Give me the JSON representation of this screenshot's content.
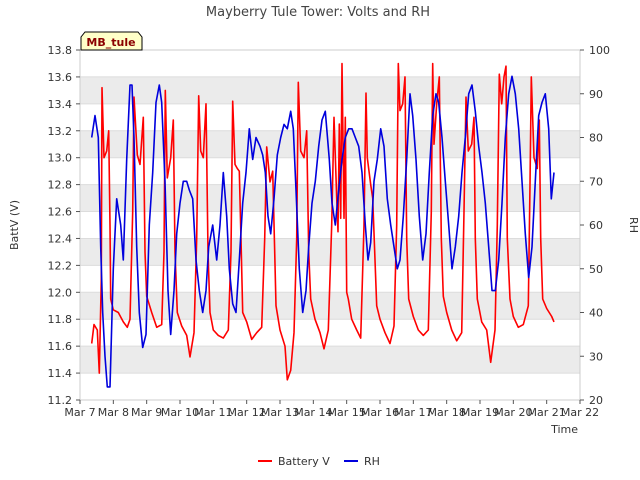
{
  "chart_data": {
    "type": "line",
    "title": "Mayberry Tule Tower: Volts and RH",
    "site_label": "MB_tule",
    "xlabel": "Time",
    "ylabel_left": "BattV (V)",
    "ylabel_right": "RH",
    "x_ticks": [
      "Mar 7",
      "Mar 8",
      "Mar 9",
      "Mar 10",
      "Mar 11",
      "Mar 12",
      "Mar 13",
      "Mar 14",
      "Mar 15",
      "Mar 16",
      "Mar 17",
      "Mar 18",
      "Mar 19",
      "Mar 20",
      "Mar 21",
      "Mar 22"
    ],
    "xlim_days": [
      7,
      22
    ],
    "ylim_left": [
      11.2,
      13.8
    ],
    "yticks_left": [
      "11.2",
      "11.4",
      "11.6",
      "11.8",
      "12.0",
      "12.2",
      "12.4",
      "12.6",
      "12.8",
      "13.0",
      "13.2",
      "13.4",
      "13.6",
      "13.8"
    ],
    "ylim_right": [
      20,
      100
    ],
    "yticks_right": [
      "20",
      "30",
      "40",
      "50",
      "60",
      "70",
      "80",
      "90",
      "100"
    ],
    "grid": true,
    "legend_position": "bottom-center",
    "colors": {
      "battery": "#ff0000",
      "rh": "#0000dd",
      "band": "#ebebeb",
      "grid": "#dcdcdc",
      "label_bg": "#ffffc8",
      "label_text": "#8b0000"
    },
    "series": [
      {
        "name": "Battery V",
        "axis": "left",
        "points": [
          [
            7.35,
            11.62
          ],
          [
            7.42,
            11.76
          ],
          [
            7.52,
            11.72
          ],
          [
            7.58,
            11.4
          ],
          [
            7.64,
            12.1
          ],
          [
            7.66,
            13.52
          ],
          [
            7.72,
            13.0
          ],
          [
            7.8,
            13.05
          ],
          [
            7.86,
            13.2
          ],
          [
            7.9,
            12.5
          ],
          [
            7.92,
            11.95
          ],
          [
            8.0,
            11.87
          ],
          [
            8.15,
            11.85
          ],
          [
            8.3,
            11.78
          ],
          [
            8.42,
            11.74
          ],
          [
            8.5,
            11.8
          ],
          [
            8.58,
            12.6
          ],
          [
            8.62,
            13.45
          ],
          [
            8.72,
            13.02
          ],
          [
            8.8,
            12.95
          ],
          [
            8.9,
            13.3
          ],
          [
            8.95,
            12.3
          ],
          [
            9.0,
            11.97
          ],
          [
            9.15,
            11.85
          ],
          [
            9.3,
            11.74
          ],
          [
            9.45,
            11.76
          ],
          [
            9.52,
            12.3
          ],
          [
            9.56,
            13.5
          ],
          [
            9.62,
            12.85
          ],
          [
            9.72,
            13.0
          ],
          [
            9.8,
            13.28
          ],
          [
            9.85,
            12.3
          ],
          [
            9.92,
            11.85
          ],
          [
            10.05,
            11.75
          ],
          [
            10.2,
            11.68
          ],
          [
            10.3,
            11.52
          ],
          [
            10.42,
            11.7
          ],
          [
            10.5,
            12.4
          ],
          [
            10.56,
            13.46
          ],
          [
            10.62,
            13.05
          ],
          [
            10.7,
            13.0
          ],
          [
            10.78,
            13.4
          ],
          [
            10.84,
            12.3
          ],
          [
            10.9,
            11.85
          ],
          [
            11.0,
            11.72
          ],
          [
            11.15,
            11.68
          ],
          [
            11.3,
            11.66
          ],
          [
            11.45,
            11.72
          ],
          [
            11.53,
            12.3
          ],
          [
            11.58,
            13.42
          ],
          [
            11.65,
            12.95
          ],
          [
            11.72,
            12.92
          ],
          [
            11.78,
            12.9
          ],
          [
            11.84,
            12.3
          ],
          [
            11.88,
            11.85
          ],
          [
            12.0,
            11.78
          ],
          [
            12.15,
            11.65
          ],
          [
            12.3,
            11.7
          ],
          [
            12.45,
            11.74
          ],
          [
            12.54,
            12.4
          ],
          [
            12.6,
            13.08
          ],
          [
            12.7,
            12.82
          ],
          [
            12.78,
            12.9
          ],
          [
            12.84,
            12.3
          ],
          [
            12.88,
            11.9
          ],
          [
            13.0,
            11.72
          ],
          [
            13.15,
            11.6
          ],
          [
            13.22,
            11.35
          ],
          [
            13.32,
            11.42
          ],
          [
            13.42,
            11.7
          ],
          [
            13.5,
            12.4
          ],
          [
            13.55,
            13.56
          ],
          [
            13.62,
            13.05
          ],
          [
            13.72,
            13.0
          ],
          [
            13.8,
            13.2
          ],
          [
            13.86,
            12.3
          ],
          [
            13.92,
            11.95
          ],
          [
            14.05,
            11.8
          ],
          [
            14.2,
            11.7
          ],
          [
            14.32,
            11.58
          ],
          [
            14.45,
            11.72
          ],
          [
            14.55,
            12.5
          ],
          [
            14.62,
            13.3
          ],
          [
            14.7,
            12.7
          ],
          [
            14.74,
            12.45
          ],
          [
            14.78,
            13.25
          ],
          [
            14.82,
            12.55
          ],
          [
            14.86,
            13.7
          ],
          [
            14.92,
            12.55
          ],
          [
            14.96,
            13.3
          ],
          [
            15.0,
            12.0
          ],
          [
            15.05,
            11.95
          ],
          [
            15.15,
            11.8
          ],
          [
            15.3,
            11.72
          ],
          [
            15.42,
            11.66
          ],
          [
            15.52,
            12.5
          ],
          [
            15.58,
            13.48
          ],
          [
            15.62,
            13.0
          ],
          [
            15.72,
            12.8
          ],
          [
            15.78,
            12.7
          ],
          [
            15.84,
            12.3
          ],
          [
            15.9,
            11.9
          ],
          [
            16.0,
            11.8
          ],
          [
            16.15,
            11.7
          ],
          [
            16.3,
            11.62
          ],
          [
            16.42,
            11.75
          ],
          [
            16.5,
            12.5
          ],
          [
            16.55,
            13.7
          ],
          [
            16.6,
            13.35
          ],
          [
            16.68,
            13.4
          ],
          [
            16.75,
            13.6
          ],
          [
            16.8,
            12.4
          ],
          [
            16.86,
            11.95
          ],
          [
            17.0,
            11.82
          ],
          [
            17.15,
            11.72
          ],
          [
            17.3,
            11.68
          ],
          [
            17.45,
            11.72
          ],
          [
            17.54,
            12.6
          ],
          [
            17.58,
            13.7
          ],
          [
            17.62,
            13.1
          ],
          [
            17.7,
            13.4
          ],
          [
            17.78,
            13.6
          ],
          [
            17.84,
            12.4
          ],
          [
            17.9,
            11.97
          ],
          [
            18.0,
            11.85
          ],
          [
            18.15,
            11.72
          ],
          [
            18.3,
            11.64
          ],
          [
            18.45,
            11.7
          ],
          [
            18.52,
            12.6
          ],
          [
            18.58,
            13.45
          ],
          [
            18.65,
            13.05
          ],
          [
            18.75,
            13.1
          ],
          [
            18.82,
            13.3
          ],
          [
            18.86,
            12.4
          ],
          [
            18.92,
            11.95
          ],
          [
            19.05,
            11.78
          ],
          [
            19.2,
            11.72
          ],
          [
            19.32,
            11.48
          ],
          [
            19.45,
            11.72
          ],
          [
            19.52,
            12.5
          ],
          [
            19.58,
            13.62
          ],
          [
            19.65,
            13.4
          ],
          [
            19.72,
            13.6
          ],
          [
            19.78,
            13.68
          ],
          [
            19.82,
            12.4
          ],
          [
            19.9,
            11.95
          ],
          [
            20.0,
            11.82
          ],
          [
            20.15,
            11.74
          ],
          [
            20.3,
            11.76
          ],
          [
            20.45,
            11.9
          ],
          [
            20.5,
            12.8
          ],
          [
            20.54,
            13.6
          ],
          [
            20.62,
            13.0
          ],
          [
            20.72,
            12.92
          ],
          [
            20.78,
            13.28
          ],
          [
            20.82,
            12.4
          ],
          [
            20.88,
            11.95
          ],
          [
            21.0,
            11.88
          ],
          [
            21.15,
            11.82
          ],
          [
            21.22,
            11.78
          ]
        ]
      },
      {
        "name": "RH",
        "axis": "right",
        "points": [
          [
            7.35,
            80
          ],
          [
            7.45,
            85
          ],
          [
            7.55,
            80
          ],
          [
            7.62,
            55
          ],
          [
            7.68,
            40
          ],
          [
            7.75,
            30
          ],
          [
            7.82,
            23
          ],
          [
            7.9,
            23
          ],
          [
            8.0,
            50
          ],
          [
            8.1,
            66
          ],
          [
            8.22,
            60
          ],
          [
            8.3,
            52
          ],
          [
            8.4,
            75
          ],
          [
            8.5,
            92
          ],
          [
            8.56,
            92
          ],
          [
            8.62,
            80
          ],
          [
            8.7,
            55
          ],
          [
            8.78,
            40
          ],
          [
            8.88,
            32
          ],
          [
            8.98,
            35
          ],
          [
            9.08,
            60
          ],
          [
            9.18,
            72
          ],
          [
            9.28,
            88
          ],
          [
            9.38,
            92
          ],
          [
            9.45,
            88
          ],
          [
            9.55,
            70
          ],
          [
            9.64,
            45
          ],
          [
            9.72,
            35
          ],
          [
            9.82,
            45
          ],
          [
            9.9,
            58
          ],
          [
            10.0,
            65
          ],
          [
            10.1,
            70
          ],
          [
            10.2,
            70
          ],
          [
            10.28,
            68
          ],
          [
            10.38,
            66
          ],
          [
            10.48,
            52
          ],
          [
            10.58,
            45
          ],
          [
            10.68,
            40
          ],
          [
            10.78,
            45
          ],
          [
            10.86,
            55
          ],
          [
            10.98,
            60
          ],
          [
            11.1,
            52
          ],
          [
            11.2,
            60
          ],
          [
            11.3,
            72
          ],
          [
            11.4,
            62
          ],
          [
            11.48,
            50
          ],
          [
            11.58,
            42
          ],
          [
            11.68,
            40
          ],
          [
            11.78,
            52
          ],
          [
            11.88,
            65
          ],
          [
            11.98,
            72
          ],
          [
            12.08,
            82
          ],
          [
            12.18,
            75
          ],
          [
            12.28,
            80
          ],
          [
            12.4,
            78
          ],
          [
            12.48,
            76
          ],
          [
            12.56,
            72
          ],
          [
            12.64,
            62
          ],
          [
            12.72,
            58
          ],
          [
            12.82,
            66
          ],
          [
            12.92,
            76
          ],
          [
            13.02,
            80
          ],
          [
            13.12,
            83
          ],
          [
            13.22,
            82
          ],
          [
            13.32,
            86
          ],
          [
            13.4,
            82
          ],
          [
            13.48,
            68
          ],
          [
            13.58,
            50
          ],
          [
            13.68,
            40
          ],
          [
            13.78,
            45
          ],
          [
            13.86,
            55
          ],
          [
            13.96,
            65
          ],
          [
            14.06,
            70
          ],
          [
            14.16,
            78
          ],
          [
            14.26,
            84
          ],
          [
            14.36,
            86
          ],
          [
            14.48,
            75
          ],
          [
            14.56,
            65
          ],
          [
            14.66,
            60
          ],
          [
            14.76,
            68
          ],
          [
            14.86,
            75
          ],
          [
            14.96,
            80
          ],
          [
            15.06,
            82
          ],
          [
            15.16,
            82
          ],
          [
            15.26,
            80
          ],
          [
            15.36,
            78
          ],
          [
            15.46,
            72
          ],
          [
            15.56,
            60
          ],
          [
            15.64,
            52
          ],
          [
            15.72,
            56
          ],
          [
            15.82,
            70
          ],
          [
            15.92,
            75
          ],
          [
            16.02,
            82
          ],
          [
            16.12,
            78
          ],
          [
            16.22,
            66
          ],
          [
            16.32,
            60
          ],
          [
            16.42,
            55
          ],
          [
            16.52,
            50
          ],
          [
            16.6,
            52
          ],
          [
            16.7,
            62
          ],
          [
            16.8,
            75
          ],
          [
            16.9,
            90
          ],
          [
            16.98,
            85
          ],
          [
            17.08,
            75
          ],
          [
            17.18,
            62
          ],
          [
            17.28,
            52
          ],
          [
            17.38,
            58
          ],
          [
            17.48,
            72
          ],
          [
            17.58,
            85
          ],
          [
            17.68,
            90
          ],
          [
            17.76,
            88
          ],
          [
            17.86,
            80
          ],
          [
            17.96,
            70
          ],
          [
            18.06,
            60
          ],
          [
            18.16,
            50
          ],
          [
            18.26,
            55
          ],
          [
            18.36,
            62
          ],
          [
            18.46,
            72
          ],
          [
            18.56,
            80
          ],
          [
            18.66,
            90
          ],
          [
            18.76,
            92
          ],
          [
            18.86,
            86
          ],
          [
            18.96,
            78
          ],
          [
            19.06,
            72
          ],
          [
            19.16,
            65
          ],
          [
            19.26,
            55
          ],
          [
            19.36,
            45
          ],
          [
            19.46,
            45
          ],
          [
            19.56,
            52
          ],
          [
            19.66,
            65
          ],
          [
            19.76,
            80
          ],
          [
            19.86,
            90
          ],
          [
            19.96,
            94
          ],
          [
            20.06,
            90
          ],
          [
            20.16,
            82
          ],
          [
            20.26,
            70
          ],
          [
            20.36,
            58
          ],
          [
            20.46,
            48
          ],
          [
            20.56,
            55
          ],
          [
            20.66,
            70
          ],
          [
            20.76,
            85
          ],
          [
            20.86,
            88
          ],
          [
            20.96,
            90
          ],
          [
            21.06,
            82
          ],
          [
            21.14,
            66
          ],
          [
            21.22,
            72
          ]
        ]
      }
    ]
  }
}
